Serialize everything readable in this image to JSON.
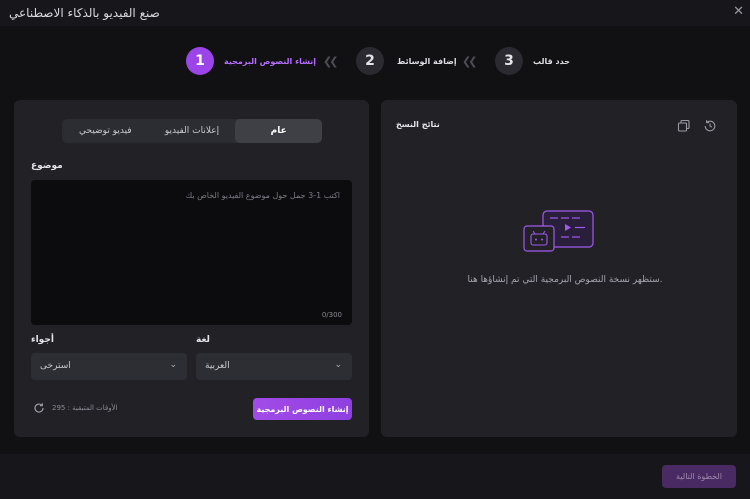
{
  "window": {
    "title": "صنع الفيديو بالذكاء الاصطناعي",
    "close_glyph": "✕"
  },
  "stepper": {
    "steps": [
      {
        "number": "1",
        "label": "إنشاء النصوص البرمجية",
        "state": "active"
      },
      {
        "number": "2",
        "label": "إضافة الوسائط",
        "state": "inactive"
      },
      {
        "number": "3",
        "label": "حدد قالب",
        "state": "inactive"
      }
    ],
    "separator": "❮❮"
  },
  "left_panel": {
    "tabs": [
      {
        "label": "عام",
        "selected": true
      },
      {
        "label": "إعلانات الفيديو",
        "selected": false
      },
      {
        "label": "فيديو توضيحي",
        "selected": false
      }
    ],
    "topic": {
      "label": "موضوع",
      "placeholder": "اكتب 1-3 جمل حول موضوع الفيديو الخاص بك",
      "counter": "0/300"
    },
    "language": {
      "label": "لغة",
      "value": "العربية"
    },
    "mood": {
      "label": "أجواء",
      "value": "استرخى"
    },
    "generate_button": "إنشاء النصوص البرمجية",
    "remaining_label": "الأوقات المتبقية : 295"
  },
  "right_panel": {
    "title": "نتائج النسخ",
    "empty_message": "ستظهر نسخة النصوص البرمجية التي تم إنشاؤها هنا.",
    "icons": [
      "history-icon",
      "copy-icon"
    ]
  },
  "footer": {
    "next_button": "الخطوة التالية"
  },
  "colors": {
    "accent": "#9b45e8",
    "panel": "#212126",
    "background": "#111114",
    "next_button_bg": "#4a2a62"
  }
}
